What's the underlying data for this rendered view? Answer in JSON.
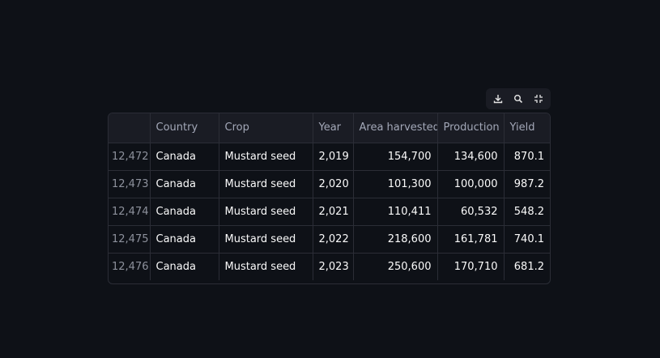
{
  "toolbar": {
    "download_icon": "download-icon",
    "search_icon": "search-icon",
    "fullscreen_icon": "collapse-icon"
  },
  "table": {
    "columns": [
      "",
      "Country",
      "Crop",
      "Year",
      "Area harvested",
      "Production",
      "Yield"
    ],
    "rows": [
      {
        "index": "12,472",
        "country": "Canada",
        "crop": "Mustard seed",
        "year": "2,019",
        "area": "154,700",
        "production": "134,600",
        "yield": "870.1"
      },
      {
        "index": "12,473",
        "country": "Canada",
        "crop": "Mustard seed",
        "year": "2,020",
        "area": "101,300",
        "production": "100,000",
        "yield": "987.2"
      },
      {
        "index": "12,474",
        "country": "Canada",
        "crop": "Mustard seed",
        "year": "2,021",
        "area": "110,411",
        "production": "60,532",
        "yield": "548.2"
      },
      {
        "index": "12,475",
        "country": "Canada",
        "crop": "Mustard seed",
        "year": "2,022",
        "area": "218,600",
        "production": "161,781",
        "yield": "740.1"
      },
      {
        "index": "12,476",
        "country": "Canada",
        "crop": "Mustard seed",
        "year": "2,023",
        "area": "250,600",
        "production": "170,710",
        "yield": "681.2"
      }
    ]
  },
  "colors": {
    "background": "#0e1117",
    "header_bg": "#1a1c24",
    "border": "#2b2d36",
    "text": "#fafafa",
    "muted_text": "#a3a8b8"
  }
}
